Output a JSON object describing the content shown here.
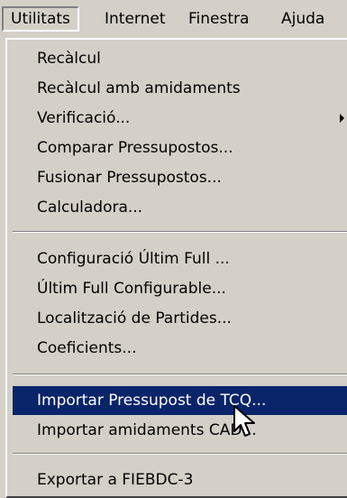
{
  "menubar": {
    "items": [
      {
        "label": "Utilitats"
      },
      {
        "label": "Internet"
      },
      {
        "label": "Finestra"
      },
      {
        "label": "Ajuda"
      }
    ]
  },
  "dropdown": {
    "items": [
      {
        "label": "Recàlcul"
      },
      {
        "label": "Recàlcul amb amidaments"
      },
      {
        "label": "Verificació..."
      },
      {
        "label": "Comparar Pressupostos..."
      },
      {
        "label": "Fusionar Pressupostos..."
      },
      {
        "label": "Calculadora..."
      },
      {
        "label": "Configuració Últim Full ..."
      },
      {
        "label": "Últim Full Configurable..."
      },
      {
        "label": "Localització de Partides..."
      },
      {
        "label": "Coeficients..."
      },
      {
        "label": "Importar Pressupost de TCQ..."
      },
      {
        "label": "Importar amidaments CAD..."
      },
      {
        "label": "Exportar a FIEBDC-3"
      }
    ]
  },
  "colors": {
    "menu_background": "#d4d0c8",
    "highlight_background": "#0a246a",
    "highlight_text": "#ffffff"
  },
  "icons": {
    "submenu": "submenu-arrow-icon",
    "cursor": "mouse-pointer-icon"
  }
}
